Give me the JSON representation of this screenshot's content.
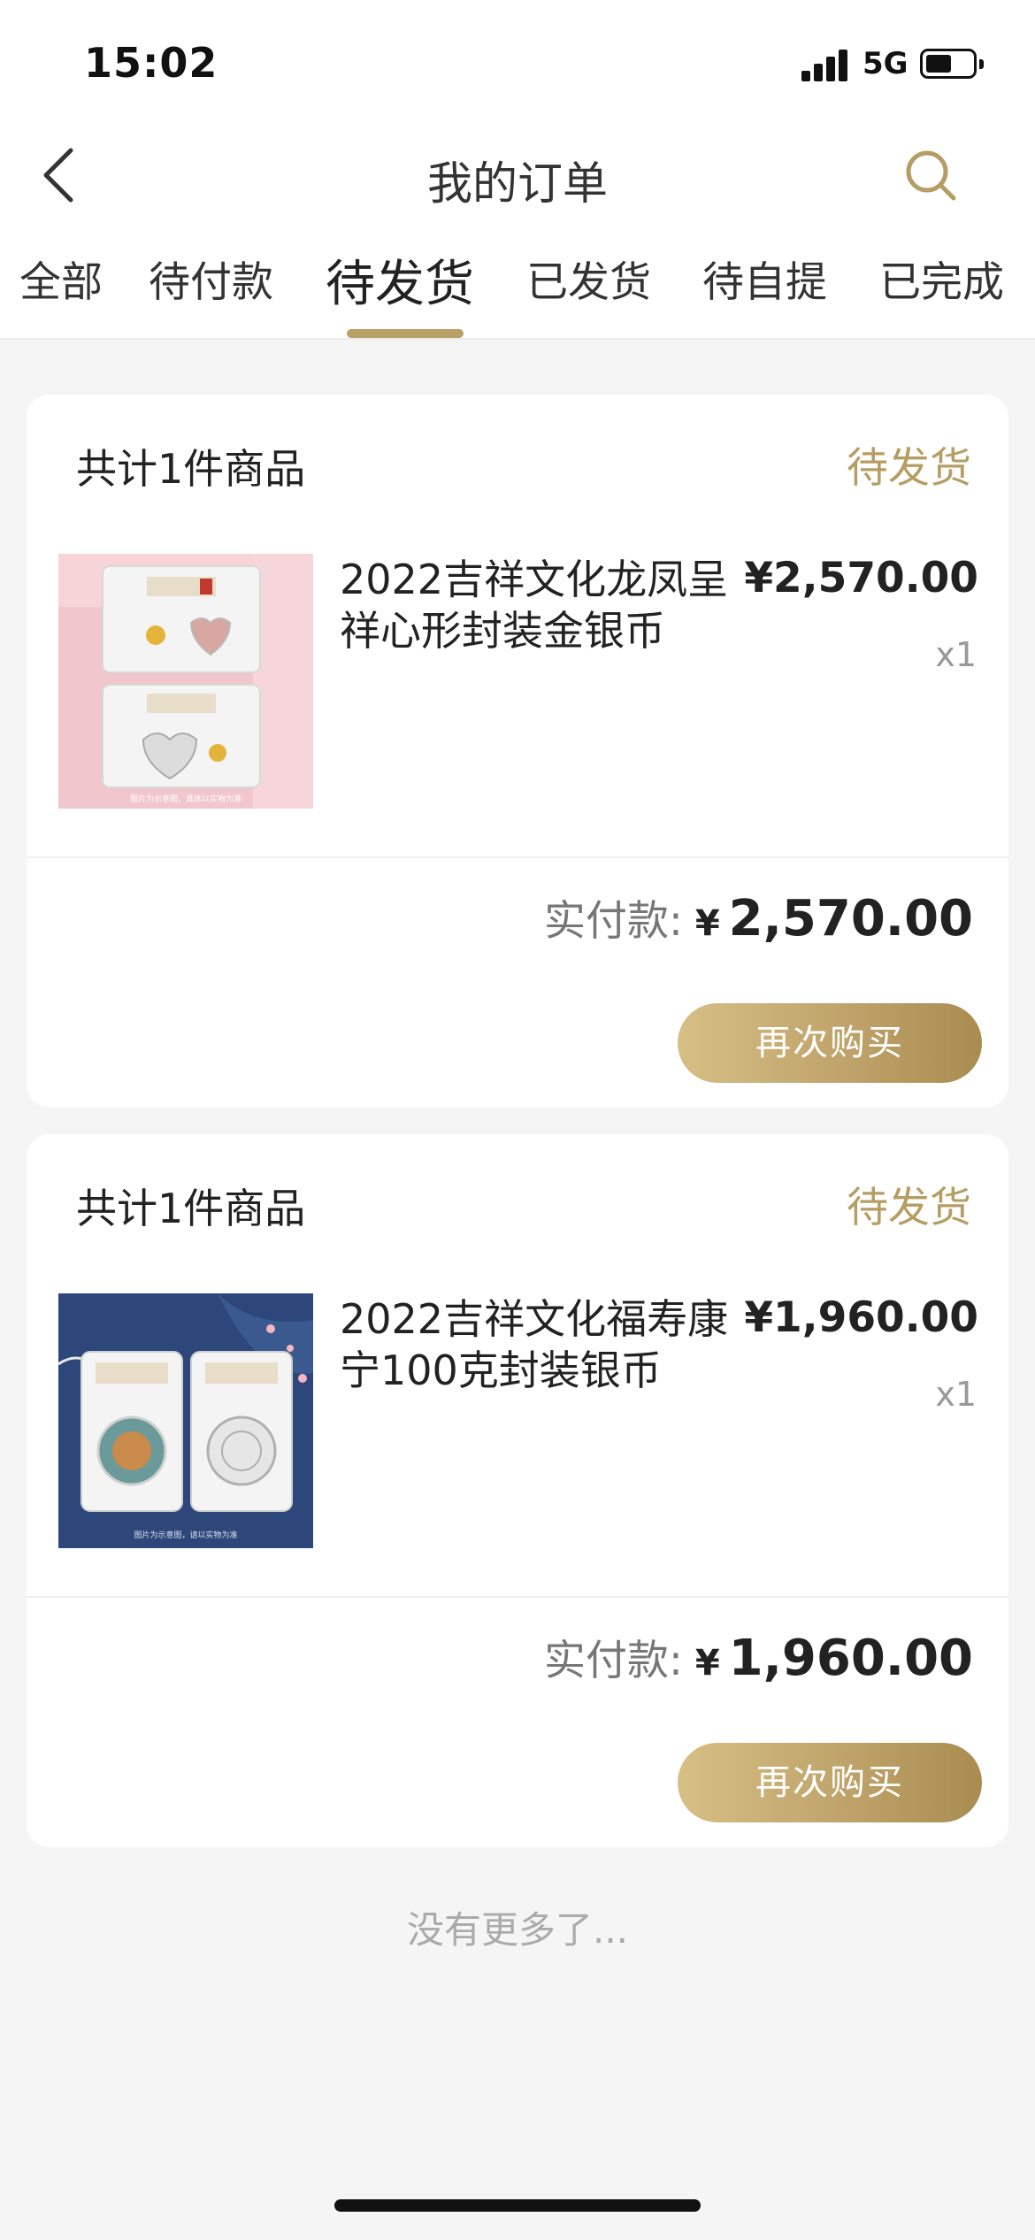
{
  "status_bar": {
    "time": "15:02",
    "network": "5G"
  },
  "nav": {
    "title": "我的订单"
  },
  "tabs": [
    {
      "label": "全部"
    },
    {
      "label": "待付款"
    },
    {
      "label": "待发货",
      "active": true
    },
    {
      "label": "已发货"
    },
    {
      "label": "待自提"
    },
    {
      "label": "已完成"
    }
  ],
  "orders": [
    {
      "count_text": "共计1件商品",
      "status": "待发货",
      "product_name": "2022吉祥文化龙凤呈祥心形封装金银币",
      "price": "¥2,570.00",
      "qty": "x1",
      "paid_label": "实付款:",
      "paid_symbol": "¥",
      "paid_amount": "2,570.00",
      "button": "再次购买",
      "image_caption": "图片为示意图，具体以实物为准"
    },
    {
      "count_text": "共计1件商品",
      "status": "待发货",
      "product_name": "2022吉祥文化福寿康宁100克封装银币",
      "price": "¥1,960.00",
      "qty": "x1",
      "paid_label": "实付款:",
      "paid_symbol": "¥",
      "paid_amount": "1,960.00",
      "button": "再次购买",
      "image_caption": "图片为示意图，请以实物为准"
    }
  ],
  "footer": {
    "no_more": "没有更多了..."
  },
  "colors": {
    "accent": "#b59d63",
    "button_start": "#d6bf85",
    "button_end": "#a98c50",
    "background": "#f5f5f5"
  }
}
